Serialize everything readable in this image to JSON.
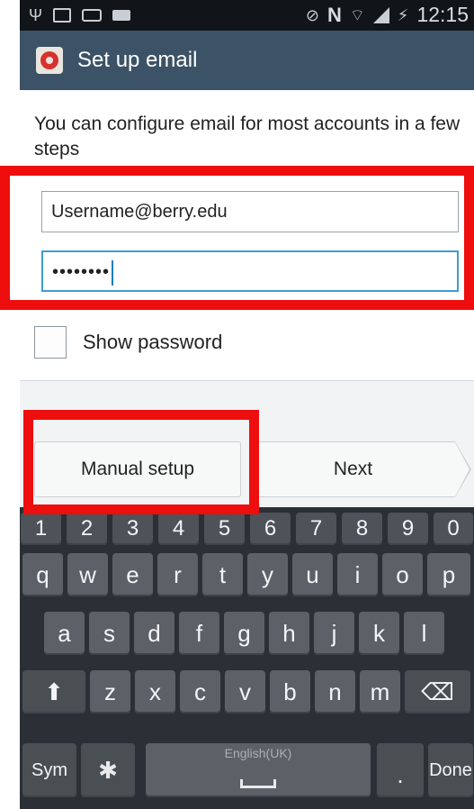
{
  "status_bar": {
    "icons": [
      "usb-icon",
      "image-icon",
      "voicemail-icon",
      "keyboard-icon",
      "nfc-icon",
      "wifi-icon",
      "signal-icon",
      "charging-icon"
    ],
    "n_badge": "N",
    "time": "12:15"
  },
  "title_bar": {
    "title": "Set up email",
    "app_icon": "email-app-icon"
  },
  "main": {
    "intro": "You can configure email for most accounts in a few steps",
    "email_field": {
      "value": "Username@berry.edu"
    },
    "password_field": {
      "value": "••••••••"
    },
    "show_password": {
      "label": "Show password",
      "checked": false
    }
  },
  "buttons": {
    "manual_setup": "Manual setup",
    "next": "Next"
  },
  "keyboard": {
    "number_row": [
      "1",
      "2",
      "3",
      "4",
      "5",
      "6",
      "7",
      "8",
      "9",
      "0"
    ],
    "row1": [
      "q",
      "w",
      "e",
      "r",
      "t",
      "y",
      "u",
      "i",
      "o",
      "p"
    ],
    "row2": [
      "a",
      "s",
      "d",
      "f",
      "g",
      "h",
      "j",
      "k",
      "l"
    ],
    "row3": [
      "z",
      "x",
      "c",
      "v",
      "b",
      "n",
      "m"
    ],
    "sym": "Sym",
    "space_lang": "English(UK)",
    "period": ".",
    "done": "Done"
  },
  "colors": {
    "status_bar": "#111418",
    "title_bar": "#3c5266",
    "focus_border": "#3e9bd6",
    "keyboard_bg": "#2b3036",
    "key": "#5b6167",
    "annotation": "#ee0e0e"
  }
}
